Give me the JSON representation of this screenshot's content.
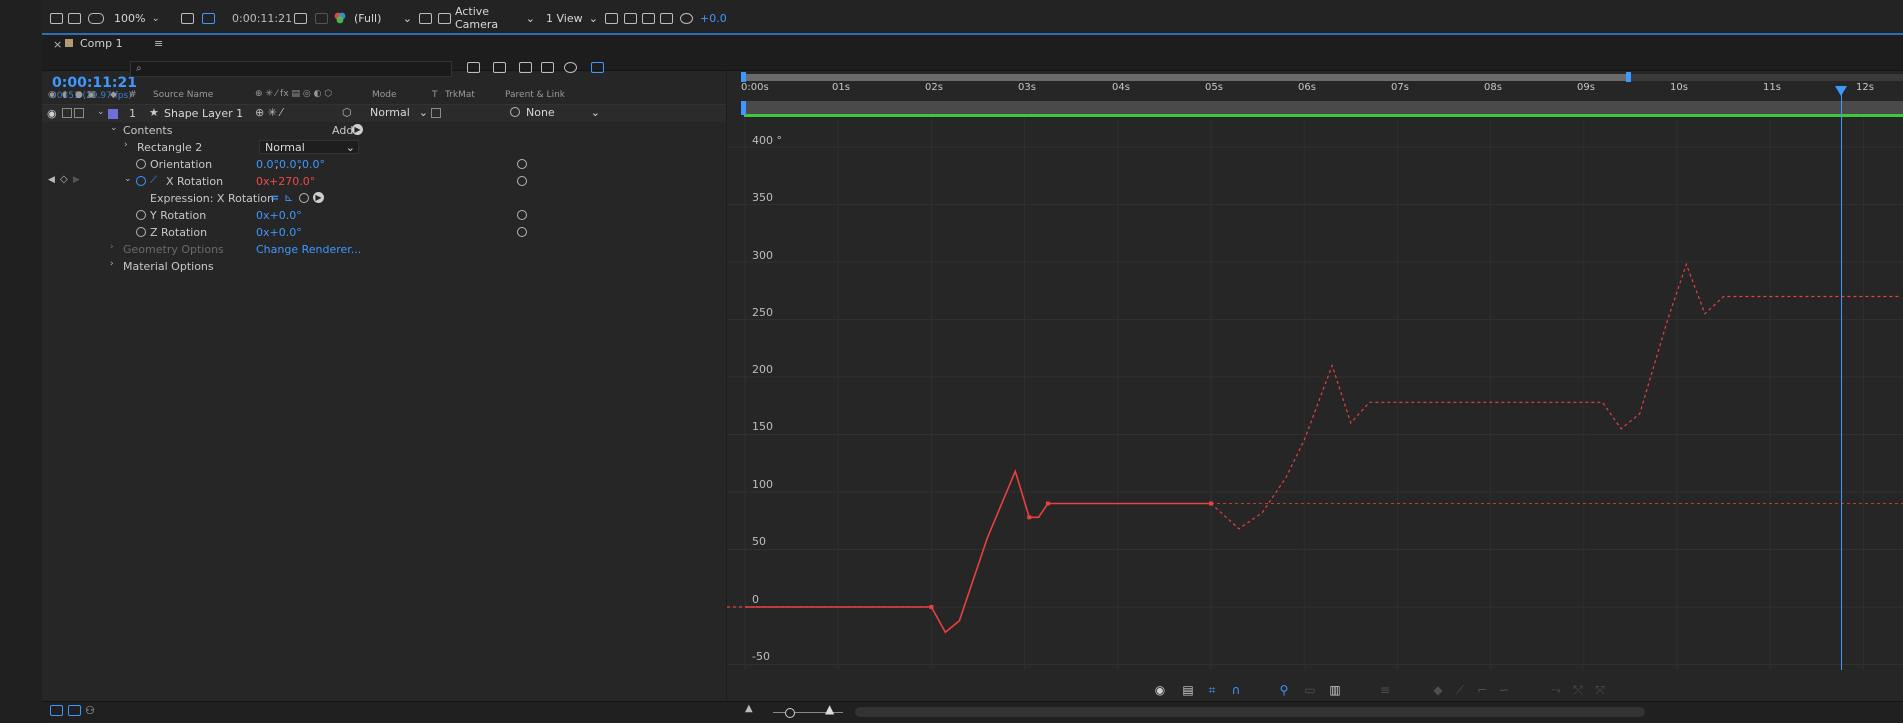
{
  "viewer": {
    "zoom": "100%",
    "timecode": "0:00:11:21",
    "resolution": "(Full)",
    "camera": "Active Camera",
    "views": "1 View",
    "exposure": "+0.0"
  },
  "comp_tab": {
    "label": "Comp 1"
  },
  "timeline": {
    "current_time": "0:00:11:21",
    "frame_info": "00351 (29.97 fps)",
    "search_placeholder": "",
    "columns": {
      "hash": "#",
      "source_name": "Source Name",
      "mode": "Mode",
      "t": "T",
      "trkmat": "TrkMat",
      "parent": "Parent & Link"
    },
    "layer": {
      "number": "1",
      "name": "Shape Layer 1",
      "mode": "Normal",
      "parent": "None",
      "color": "#6b6fd6"
    },
    "contents_label": "Contents",
    "add_label": "Add:",
    "rectangle": {
      "name": "Rectangle 2",
      "mode": "Normal"
    },
    "orientation": {
      "label": "Orientation",
      "v1": "0.0°",
      "v2": "0.0°",
      "v3": "0.0°"
    },
    "x_rotation": {
      "label": "X Rotation",
      "rev": "0x",
      "deg": "+270.0°"
    },
    "expression_label": "Expression: X Rotation",
    "y_rotation": {
      "label": "Y Rotation",
      "value": "0x+0.0°"
    },
    "z_rotation": {
      "label": "Z Rotation",
      "value": "0x+0.0°"
    },
    "geometry_label": "Geometry Options",
    "change_renderer": "Change Renderer...",
    "material_label": "Material Options"
  },
  "graph": {
    "time_labels": [
      "0:00s",
      "01s",
      "02s",
      "03s",
      "04s",
      "05s",
      "06s",
      "07s",
      "08s",
      "09s",
      "10s",
      "11s",
      "12s"
    ],
    "value_labels": [
      "400 °",
      "350",
      "300",
      "250",
      "200",
      "150",
      "100",
      "50",
      "0",
      "-50"
    ],
    "curve_color": "#e94040",
    "playhead_color": "#3d98ff"
  },
  "chart_data": {
    "type": "line",
    "title": "",
    "xlabel": "",
    "ylabel": "",
    "xlim": [
      0,
      12.4
    ],
    "ylim": [
      -55,
      405
    ],
    "series": [
      {
        "x": [
          0.0,
          2.0,
          2.15,
          2.3,
          2.6,
          2.9,
          3.05,
          3.15,
          3.25,
          3.4,
          5.0,
          5.3,
          5.55,
          5.8,
          6.0
        ],
        "y": [
          0,
          0,
          -22,
          -12,
          60,
          118,
          78,
          78,
          90,
          90,
          90,
          68,
          82,
          112,
          145
        ]
      },
      {
        "x": [
          6.0,
          6.3,
          6.5,
          6.7,
          6.8,
          8.0,
          9.2,
          9.4,
          9.6,
          9.9,
          10.1,
          10.3,
          10.5,
          12.4
        ],
        "y": [
          145,
          210,
          160,
          178,
          178,
          178,
          178,
          155,
          168,
          250,
          298,
          255,
          270,
          270
        ]
      }
    ],
    "playhead_time": 11.7
  }
}
